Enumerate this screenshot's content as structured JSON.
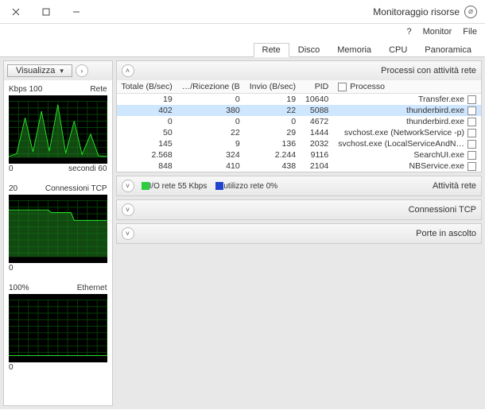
{
  "window": {
    "title": "Monitoraggio risorse"
  },
  "menu": {
    "file": "File",
    "monitor": "Monitor",
    "help": "?"
  },
  "tabs": {
    "panoramica": "Panoramica",
    "cpu": "CPU",
    "memoria": "Memoria",
    "disco": "Disco",
    "rete": "Rete"
  },
  "sections": {
    "processes": {
      "title": "Processi con attività rete",
      "cols": {
        "process": "Processo",
        "pid": "PID",
        "send": "Invio (B/sec)",
        "recv": "Ricezione (B/…",
        "total": "Totale (B/sec)"
      },
      "rows": [
        {
          "name": "Transfer.exe",
          "pid": "10640",
          "send": "19",
          "recv": "0",
          "total": "19",
          "selected": false
        },
        {
          "name": "thunderbird.exe",
          "pid": "5088",
          "send": "22",
          "recv": "380",
          "total": "402",
          "selected": true
        },
        {
          "name": "thunderbird.exe",
          "pid": "4672",
          "send": "0",
          "recv": "0",
          "total": "0",
          "selected": false
        },
        {
          "name": "svchost.exe (NetworkService -p)",
          "pid": "1444",
          "send": "29",
          "recv": "22",
          "total": "50",
          "selected": false
        },
        {
          "name": "svchost.exe (LocalServiceAndN…",
          "pid": "2032",
          "send": "136",
          "recv": "9",
          "total": "145",
          "selected": false
        },
        {
          "name": "SearchUI.exe",
          "pid": "9116",
          "send": "2.244",
          "recv": "324",
          "total": "2.568",
          "selected": false
        },
        {
          "name": "NBService.exe",
          "pid": "2104",
          "send": "438",
          "recv": "410",
          "total": "848",
          "selected": false
        }
      ]
    },
    "network_activity": {
      "title": "Attività rete",
      "legend_io": "I/O rete 55 Kbps",
      "legend_util": "0% utilizzo rete"
    },
    "tcp_connections": {
      "title": "Connessioni TCP"
    },
    "listening_ports": {
      "title": "Porte in ascolto"
    }
  },
  "sidebar": {
    "views_label": "Visualizza",
    "charts": [
      {
        "title": "Rete",
        "right": "100 Kbps",
        "foot_left": "60 secondi",
        "foot_right": "0"
      },
      {
        "title": "Connessioni TCP",
        "right": "20",
        "foot_left": "",
        "foot_right": "0"
      },
      {
        "title": "Ethernet",
        "right": "100%",
        "foot_left": "",
        "foot_right": "0"
      }
    ]
  },
  "chart_data": [
    {
      "type": "line",
      "title": "Rete",
      "ylabel": "",
      "ylim": [
        0,
        100
      ],
      "x": [
        0,
        5,
        10,
        15,
        20,
        25,
        30,
        35,
        40,
        45,
        50,
        55,
        60
      ],
      "series": [
        {
          "name": "io",
          "values": [
            2,
            5,
            70,
            10,
            85,
            12,
            95,
            8,
            65,
            5,
            40,
            3,
            2
          ]
        }
      ]
    },
    {
      "type": "line",
      "title": "Connessioni TCP",
      "ylabel": "",
      "ylim": [
        0,
        20
      ],
      "x": [
        0,
        5,
        10,
        15,
        20,
        25,
        30,
        35,
        40,
        45,
        50,
        55,
        60
      ],
      "series": [
        {
          "name": "count",
          "values": [
            17,
            17,
            17,
            17,
            17,
            16,
            16,
            16,
            13,
            13,
            13,
            13,
            13
          ]
        }
      ]
    },
    {
      "type": "line",
      "title": "Ethernet",
      "ylabel": "",
      "ylim": [
        0,
        100
      ],
      "x": [
        0,
        5,
        10,
        15,
        20,
        25,
        30,
        35,
        40,
        45,
        50,
        55,
        60
      ],
      "series": [
        {
          "name": "util",
          "values": [
            0,
            0,
            0,
            0,
            0,
            0,
            0,
            0,
            0,
            0,
            0,
            0,
            0
          ]
        }
      ]
    }
  ]
}
